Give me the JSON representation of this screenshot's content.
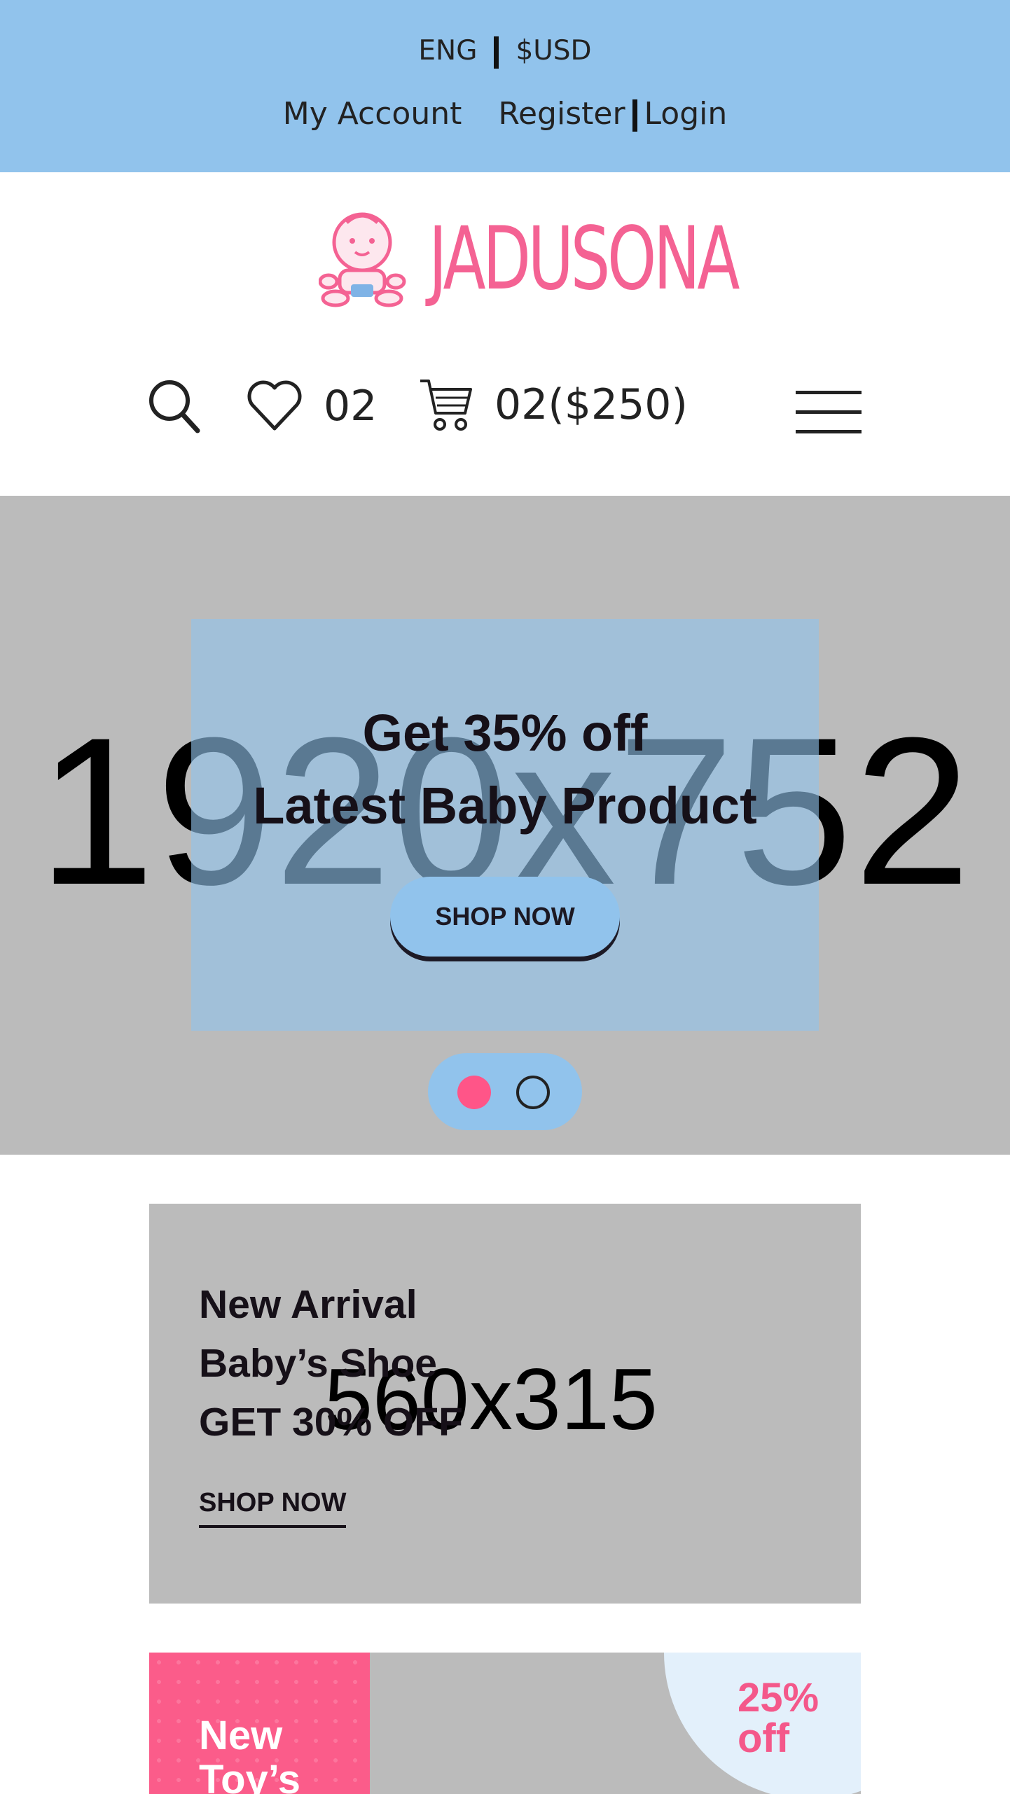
{
  "topbar": {
    "language": "ENG",
    "currency": "$USD",
    "my_account": "My Account",
    "register": "Register",
    "login": "Login"
  },
  "logo": {
    "text": "JADUSONA"
  },
  "icons": {
    "wishlist_count": "02",
    "cart_summary": "02($250)"
  },
  "hero": {
    "placeholder": "1920x752",
    "title_line1": "Get 35% off",
    "title_line2": "Latest Baby Product",
    "button": "SHOP NOW",
    "slide_count": 2,
    "active_slide": 1
  },
  "banner1": {
    "placeholder": "560x315",
    "line1": "New Arrival",
    "line2": "Baby’s Shoe",
    "line3": "GET 30% OFF",
    "link": "SHOP NOW"
  },
  "banner2": {
    "line1": "New",
    "line2": "Toy’s",
    "discount_line1": "25%",
    "discount_line2": "off"
  },
  "colors": {
    "top_bar": "#91c3ec",
    "accent_pink": "#f46293",
    "placeholder_gray": "#bbbbbb"
  }
}
